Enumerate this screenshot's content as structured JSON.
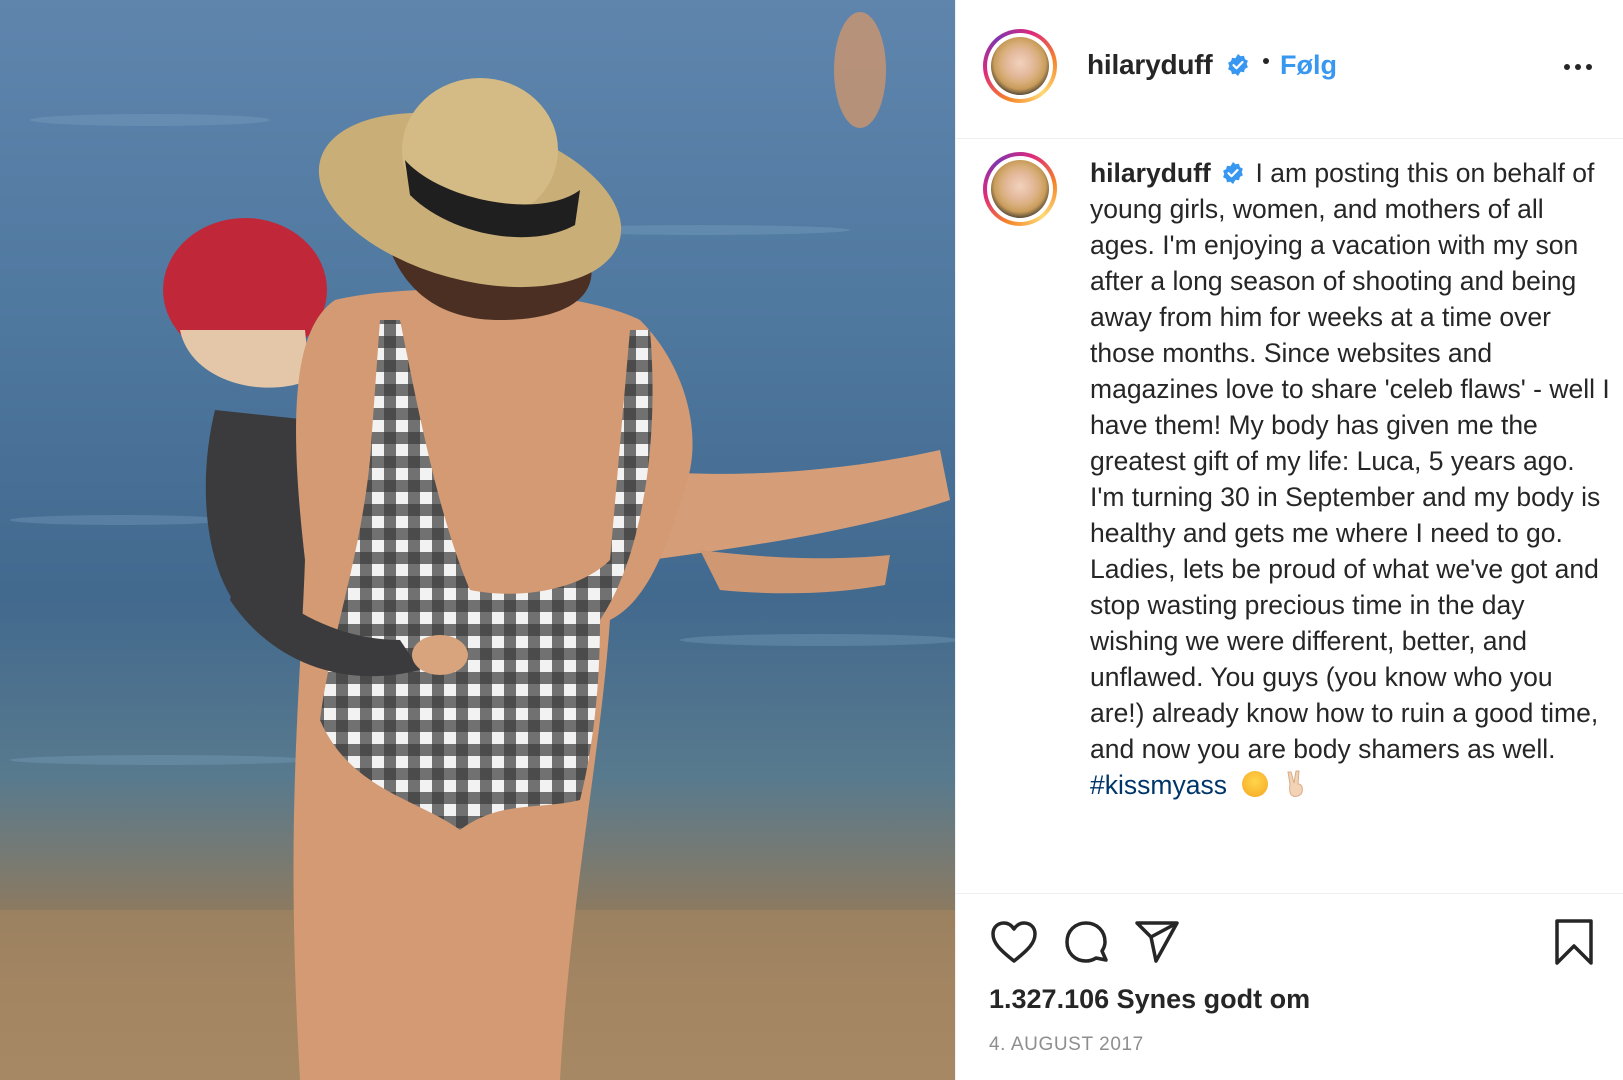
{
  "post": {
    "image_alt": "Woman in straw hat and gingham swimsuit carrying child at beach",
    "header": {
      "username": "hilaryduff",
      "follow_label": "Følg",
      "verified_icon": "verified-badge-icon",
      "more_icon": "more-options-icon"
    },
    "caption": {
      "username": "hilaryduff",
      "text": "I am posting this on behalf of young girls, women, and mothers of all ages. I'm enjoying a vacation with my son after a long season of shooting and being away from him for weeks at a time over those months. Since websites and magazines love to share 'celeb flaws' - well I have them! My body has given me the greatest gift of my life: Luca, 5 years ago. I'm turning 30 in September and my body is healthy and gets me where I need to go. Ladies, lets be proud of what we've got and stop wasting precious time in the day wishing we were different, better, and unflawed. You guys (you know who you are!) already know how to ruin a good time, and now you are body shamers as well.",
      "hashtag": "#kissmyass",
      "emojis": [
        "tongue-face-emoji",
        "victory-hand-emoji"
      ]
    },
    "actions": [
      "like-icon",
      "comment-icon",
      "share-icon",
      "save-icon"
    ],
    "likes_text": "1.327.106 Synes godt om",
    "date": "4. AUGUST 2017"
  },
  "colors": {
    "link_blue": "#3897f0",
    "hashtag_blue": "#003569",
    "text": "#262626",
    "muted": "#8e8e8e",
    "divider": "#efefef"
  }
}
